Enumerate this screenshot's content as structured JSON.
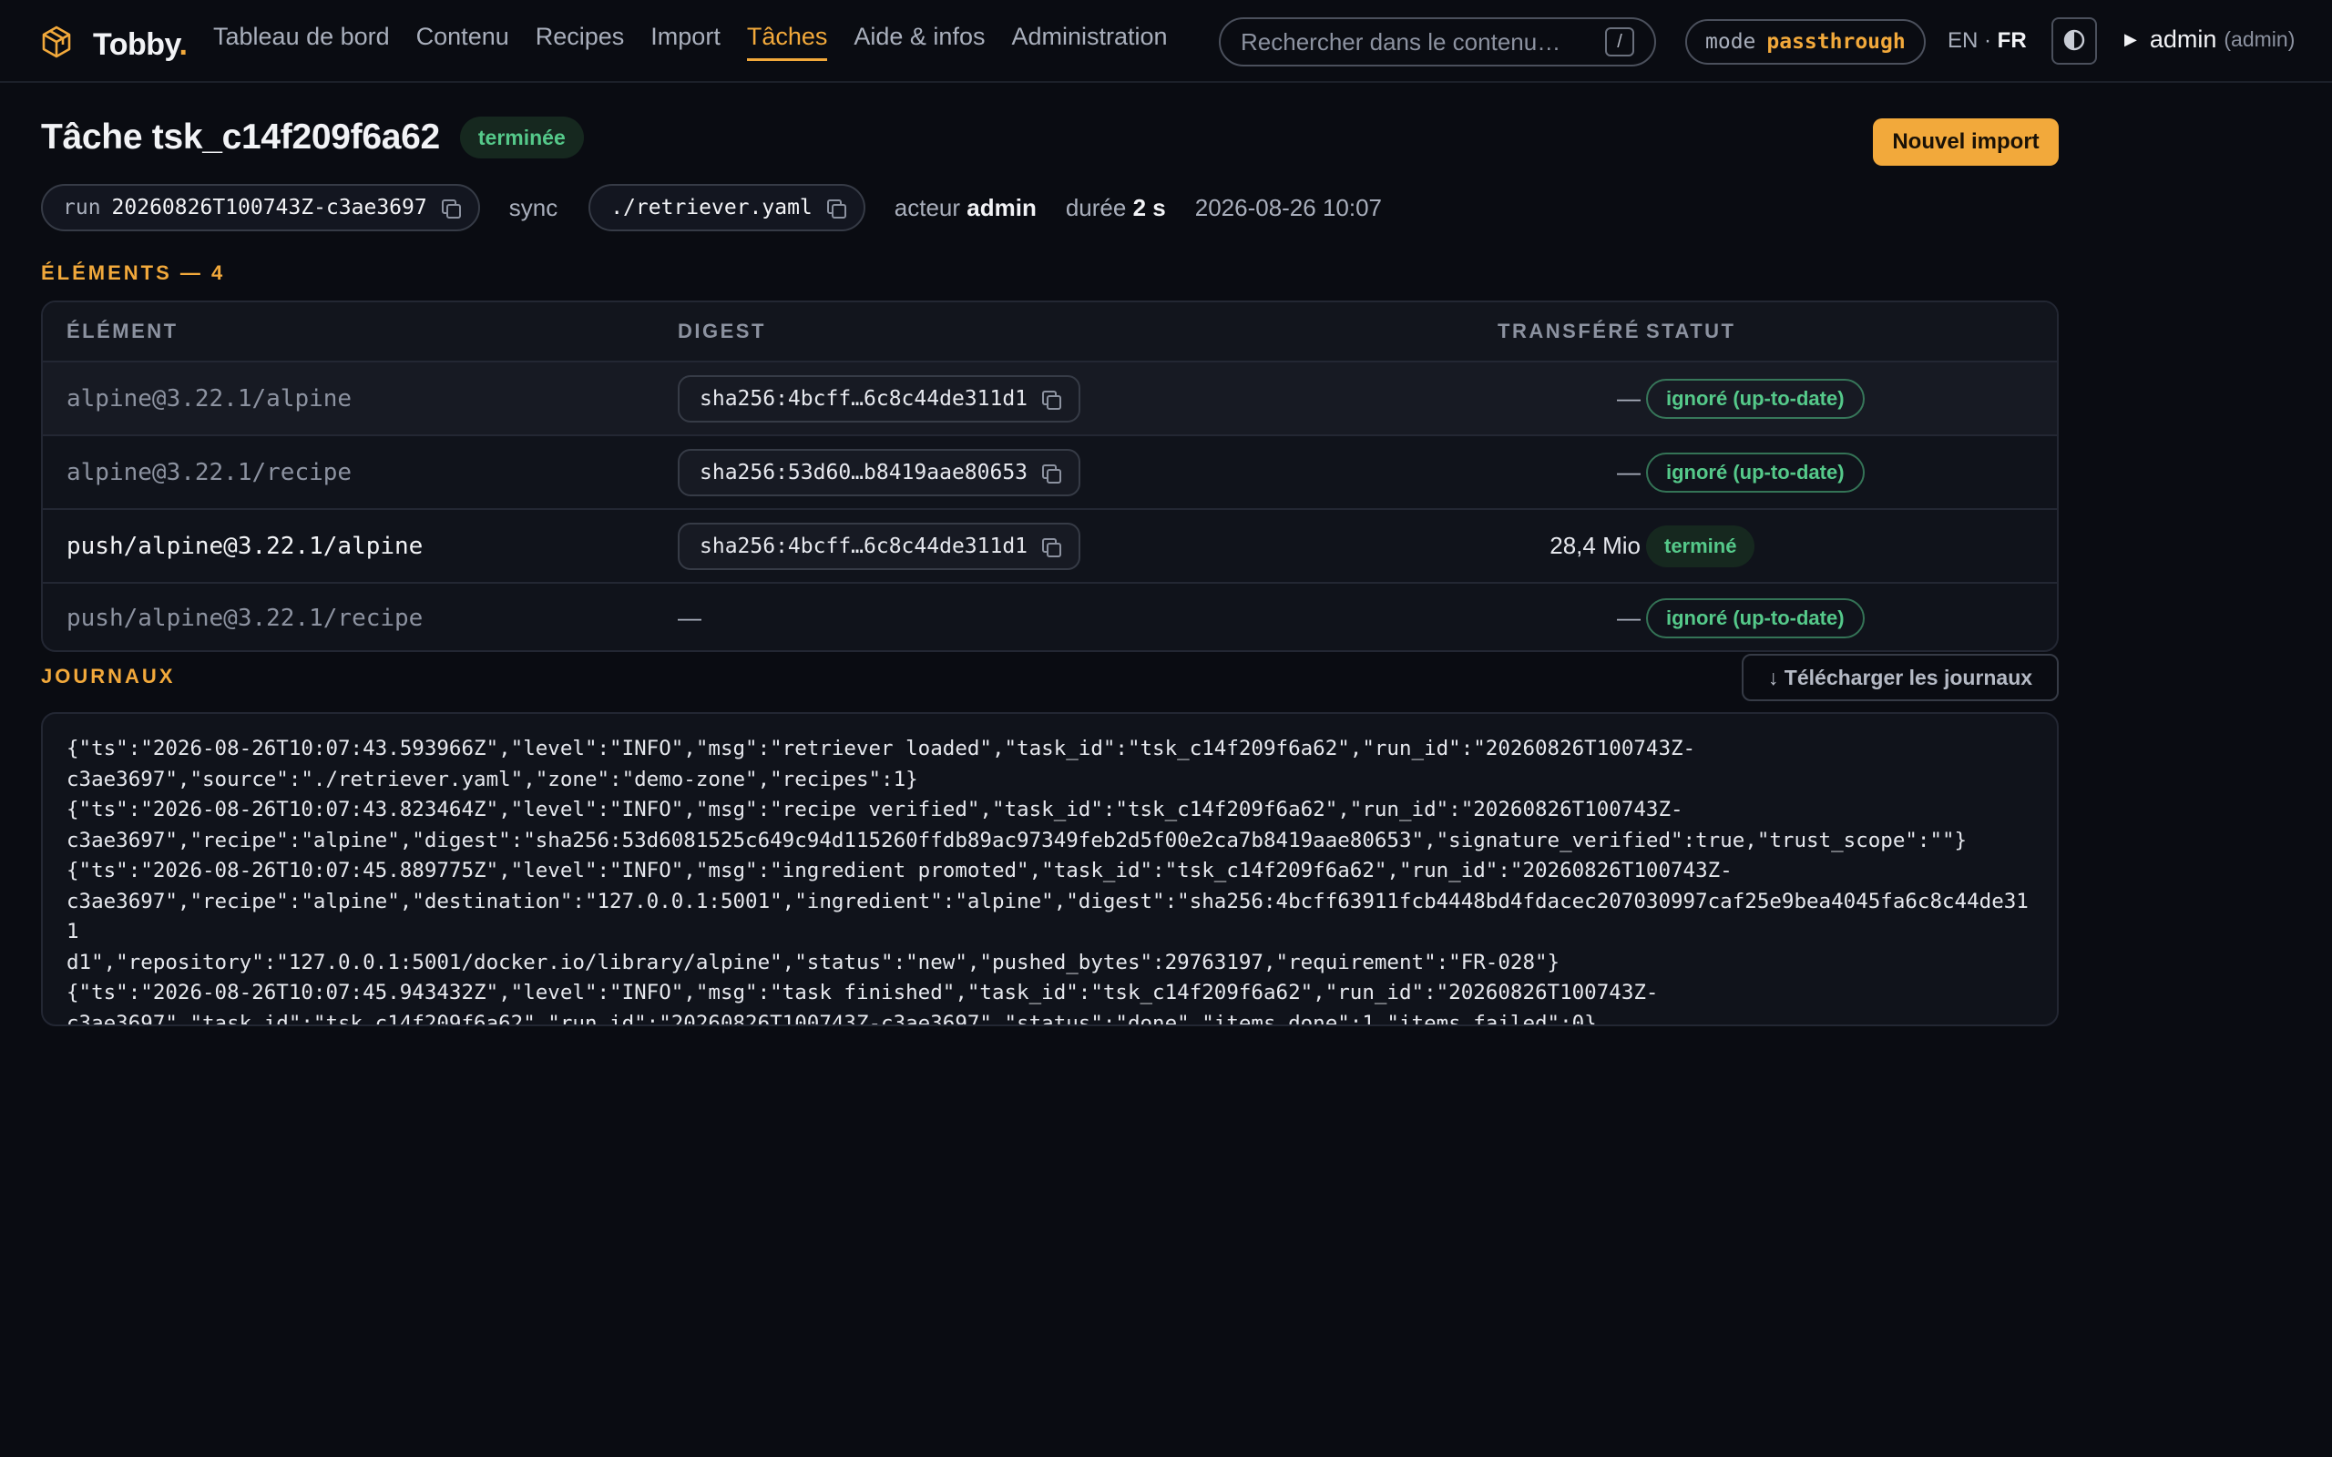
{
  "brand": {
    "name": "Tobby",
    "dot": "."
  },
  "nav": [
    {
      "label": "Tableau de bord",
      "active": false
    },
    {
      "label": "Contenu",
      "active": false
    },
    {
      "label": "Recipes",
      "active": false
    },
    {
      "label": "Import",
      "active": false
    },
    {
      "label": "Tâches",
      "active": true
    },
    {
      "label": "Aide & infos",
      "active": false
    },
    {
      "label": "Administration",
      "active": false
    }
  ],
  "search": {
    "placeholder": "Rechercher dans le contenu…",
    "shortcut": "/"
  },
  "mode": {
    "label": "mode",
    "value": "passthrough"
  },
  "lang": {
    "en": "EN",
    "sep": " · ",
    "fr": "FR"
  },
  "user": {
    "name": "admin",
    "role": "(admin)"
  },
  "task": {
    "title": "Tâche tsk_c14f209f6a62",
    "status": "terminée",
    "new_import": "Nouvel import",
    "run_label": "run",
    "run_id": "20260826T100743Z-c3ae3697",
    "kind": "sync",
    "source": "./retriever.yaml",
    "actor_label": "acteur",
    "actor": "admin",
    "duration_label": "durée",
    "duration": "2 s",
    "date": "2026-08-26 10:07"
  },
  "items_section": "ÉLÉMENTS — 4",
  "table": {
    "headers": {
      "element": "ÉLÉMENT",
      "digest": "DIGEST",
      "transferred": "TRANSFÉRÉ",
      "status": "STATUT"
    },
    "rows": [
      {
        "element": "alpine@3.22.1/alpine",
        "digest": "sha256:4bcff…6c8c44de311d1",
        "transferred": "—",
        "status": "ignoré (up-to-date)"
      },
      {
        "element": "alpine@3.22.1/recipe",
        "digest": "sha256:53d60…b8419aae80653",
        "transferred": "—",
        "status": "ignoré (up-to-date)"
      },
      {
        "element": "push/alpine@3.22.1/alpine",
        "digest": "sha256:4bcff…6c8c44de311d1",
        "transferred": "28,4 Mio",
        "status": "terminé"
      },
      {
        "element": "push/alpine@3.22.1/recipe",
        "digest": "—",
        "transferred": "—",
        "status": "ignoré (up-to-date)"
      }
    ]
  },
  "logs_section": "JOURNAUX",
  "download_logs": "↓ Télécharger les journaux",
  "logs": [
    "{\"ts\":\"2026-08-26T10:07:43.593966Z\",\"level\":\"INFO\",\"msg\":\"retriever loaded\",\"task_id\":\"tsk_c14f209f6a62\",\"run_id\":\"20260826T100743Z-\nc3ae3697\",\"source\":\"./retriever.yaml\",\"zone\":\"demo-zone\",\"recipes\":1}",
    "{\"ts\":\"2026-08-26T10:07:43.823464Z\",\"level\":\"INFO\",\"msg\":\"recipe verified\",\"task_id\":\"tsk_c14f209f6a62\",\"run_id\":\"20260826T100743Z-\nc3ae3697\",\"recipe\":\"alpine\",\"digest\":\"sha256:53d6081525c649c94d115260ffdb89ac97349feb2d5f00e2ca7b8419aae80653\",\"signature_verified\":true,\"trust_scope\":\"\"}",
    "{\"ts\":\"2026-08-26T10:07:45.889775Z\",\"level\":\"INFO\",\"msg\":\"ingredient promoted\",\"task_id\":\"tsk_c14f209f6a62\",\"run_id\":\"20260826T100743Z-\nc3ae3697\",\"recipe\":\"alpine\",\"destination\":\"127.0.0.1:5001\",\"ingredient\":\"alpine\",\"digest\":\"sha256:4bcff63911fcb4448bd4fdacec207030997caf25e9bea4045fa6c8c44de311\nd1\",\"repository\":\"127.0.0.1:5001/docker.io/library/alpine\",\"status\":\"new\",\"pushed_bytes\":29763197,\"requirement\":\"FR-028\"}",
    "{\"ts\":\"2026-08-26T10:07:45.943432Z\",\"level\":\"INFO\",\"msg\":\"task finished\",\"task_id\":\"tsk_c14f209f6a62\",\"run_id\":\"20260826T100743Z-\nc3ae3697\",\"task_id\":\"tsk_c14f209f6a62\",\"run_id\":\"20260826T100743Z-c3ae3697\",\"status\":\"done\",\"items_done\":1,\"items_failed\":0}"
  ],
  "colors": {
    "accent": "#f2a93b",
    "success": "#55c98a",
    "background": "#0a0c12"
  }
}
